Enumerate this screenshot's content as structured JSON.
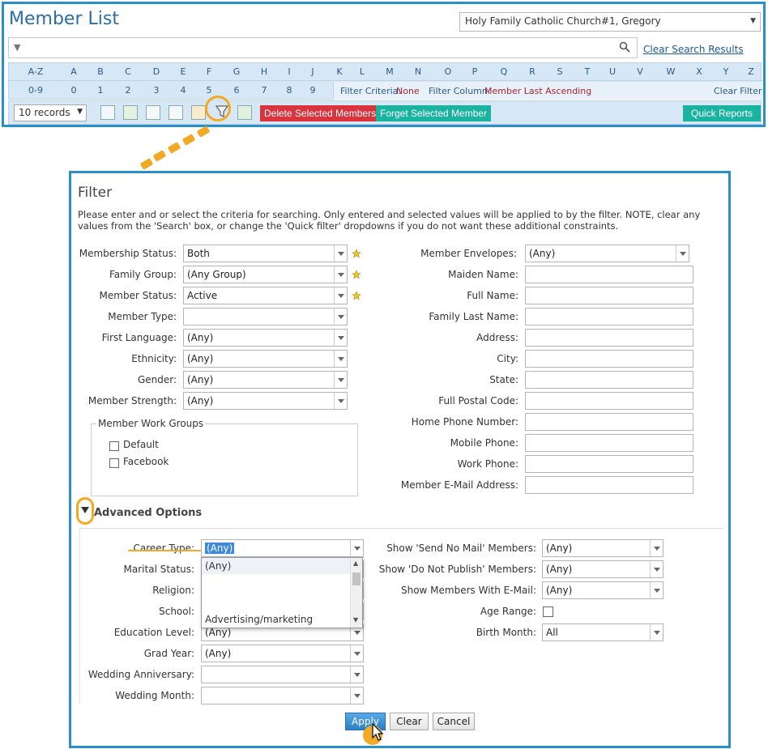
{
  "header": {
    "title": "Member List",
    "church": "Holy Family Catholic Church#1, Gregory",
    "clear_search": "Clear Search Results"
  },
  "alpha": {
    "row1": [
      "A-Z",
      "A",
      "B",
      "C",
      "D",
      "E",
      "F",
      "G",
      "H",
      "I",
      "J",
      "K",
      "L",
      "M",
      "N",
      "O",
      "P",
      "Q",
      "R",
      "S",
      "T",
      "U",
      "V",
      "W",
      "X",
      "Y",
      "Z"
    ],
    "row2": [
      "0-9",
      "0",
      "1",
      "2",
      "3",
      "4",
      "5",
      "6",
      "7",
      "8",
      "9"
    ],
    "filter_criteria_label": "Filter Criteria:",
    "filter_criteria_value": "None",
    "filter_column_label": "Filter Column:",
    "filter_column_value": "Member Last Ascending",
    "clear_filter": "Clear Filter"
  },
  "toolbar": {
    "records": "10 records",
    "delete_selected": "Delete Selected Members",
    "forget_selected": "Forget Selected Member",
    "quick_reports": "Quick Reports"
  },
  "filter": {
    "title": "Filter",
    "description": "Please enter and or select the criteria for searching. Only entered and selected values will be applied to by the filter. NOTE, clear any values from the 'Search' box, or change the 'Quick filter' dropdowns if you do not want these additional constraints.",
    "left_fields": [
      {
        "label": "Membership Status:",
        "value": "Both",
        "star": true
      },
      {
        "label": "Family Group:",
        "value": "(Any Group)",
        "star": true
      },
      {
        "label": "Member Status:",
        "value": "Active",
        "star": true
      },
      {
        "label": "Member Type:",
        "value": "",
        "star": false
      },
      {
        "label": "First Language:",
        "value": "(Any)",
        "star": false
      },
      {
        "label": "Ethnicity:",
        "value": "(Any)",
        "star": false
      },
      {
        "label": "Gender:",
        "value": "(Any)",
        "star": false
      },
      {
        "label": "Member Strength:",
        "value": "(Any)",
        "star": false
      }
    ],
    "work_groups": {
      "legend": "Member Work Groups",
      "items": [
        "Default",
        "Facebook"
      ]
    },
    "right_fields": {
      "envelopes_label": "Member Envelopes:",
      "envelopes_value": "(Any)",
      "text_labels": [
        "Maiden Name:",
        "Full Name:",
        "Family Last Name:",
        "Address:",
        "City:",
        "State:",
        "Full Postal Code:",
        "Home Phone Number:",
        "Mobile Phone:",
        "Work Phone:",
        "Member E-Mail Address:"
      ]
    },
    "advanced": {
      "title": "Advanced Options",
      "left": [
        {
          "label": "Career Type:",
          "value": "(Any)"
        },
        {
          "label": "Marital Status:",
          "value": ""
        },
        {
          "label": "Religion:",
          "value": ""
        },
        {
          "label": "School:",
          "value": ""
        },
        {
          "label": "Education Level:",
          "value": "(Any)"
        },
        {
          "label": "Grad Year:",
          "value": "(Any)"
        },
        {
          "label": "Wedding Anniversary:",
          "value": ""
        },
        {
          "label": "Wedding Month:",
          "value": ""
        }
      ],
      "dropdown_options": [
        "(Any)",
        "Advertising/marketing"
      ],
      "right": [
        {
          "label": "Show 'Send No Mail' Members:",
          "value": "(Any)"
        },
        {
          "label": "Show 'Do Not Publish' Members:",
          "value": "(Any)"
        },
        {
          "label": "Show Members With E-Mail:",
          "value": "(Any)"
        }
      ],
      "age_range_label": "Age Range:",
      "birth_month_label": "Birth Month:",
      "birth_month_value": "All"
    },
    "buttons": {
      "apply": "Apply",
      "clear": "Clear",
      "cancel": "Cancel"
    }
  },
  "colors": {
    "accent": "#2a8fc9",
    "highlight": "#f2a924",
    "danger": "#d9343e",
    "teal": "#1ab3a0"
  }
}
